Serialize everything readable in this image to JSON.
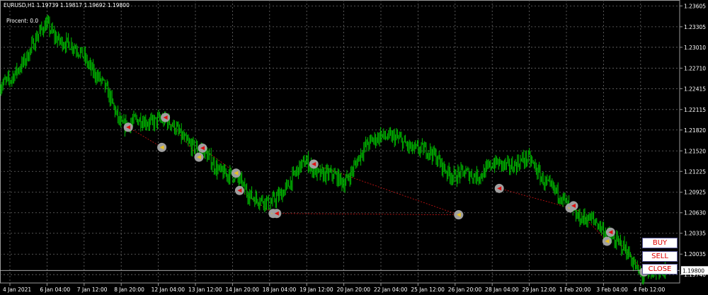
{
  "header": {
    "symbol_line": "EURUSD,H1  1.19739 1.19817 1.19692 1.19800",
    "procent": "Procent: 0.0"
  },
  "buttons": {
    "buy": "BUY",
    "sell": "SELL",
    "close": "CLOSE"
  },
  "colors": {
    "background": "#000000",
    "price": "#00c000",
    "grid": "#6b6b6b",
    "axis_text": "#ffffff",
    "trade_line": "#d01414",
    "marker_ring": "#a0a0a0",
    "button_text": "#e00000"
  },
  "price_axis": {
    "labels": [
      "1.23605",
      "1.23305",
      "1.23010",
      "1.22710",
      "1.22415",
      "1.22115",
      "1.21820",
      "1.21520",
      "1.21225",
      "1.20925",
      "1.20630",
      "1.20335",
      "1.20035",
      "1.19740"
    ],
    "current": "1.19800"
  },
  "time_axis": {
    "labels": [
      "4 Jan 2021",
      "6 Jan 04:00",
      "7 Jan 12:00",
      "8 Jan 20:00",
      "12 Jan 04:00",
      "13 Jan 12:00",
      "14 Jan 20:00",
      "18 Jan 04:00",
      "19 Jan 12:00",
      "20 Jan 20:00",
      "22 Jan 04:00",
      "25 Jan 12:00",
      "26 Jan 20:00",
      "28 Jan 04:00",
      "29 Jan 12:00",
      "1 Feb 20:00",
      "3 Feb 04:00",
      "4 Feb 12:00"
    ]
  },
  "chart_data": {
    "type": "line",
    "title": "EURUSD,H1",
    "ylim": [
      1.1962,
      1.2369
    ],
    "x": [
      "4 Jan 2021",
      "6 Jan 04:00",
      "7 Jan 12:00",
      "8 Jan 20:00",
      "12 Jan 04:00",
      "13 Jan 12:00",
      "14 Jan 20:00",
      "18 Jan 04:00",
      "19 Jan 12:00",
      "20 Jan 20:00",
      "22 Jan 04:00",
      "25 Jan 12:00",
      "26 Jan 20:00",
      "28 Jan 04:00",
      "29 Jan 12:00",
      "1 Feb 20:00",
      "3 Feb 04:00",
      "4 Feb 12:00"
    ],
    "series": [
      {
        "values": [
          1.2245,
          1.2335,
          1.229,
          1.219,
          1.2205,
          1.215,
          1.212,
          1.2065,
          1.214,
          1.2105,
          1.218,
          1.216,
          1.211,
          1.2135,
          1.213,
          1.208,
          1.2035,
          1.198
        ]
      }
    ],
    "trades": [
      {
        "type": "sell",
        "open_time": "8 Jan 20:00",
        "open_price": 1.2186,
        "close_time": "12 Jan 04:00",
        "close_price": 1.2157
      },
      {
        "type": "sell",
        "open_time": "12 Jan 04:00",
        "open_price": 1.22,
        "close_time": "13 Jan 12:00",
        "close_price": 1.2143
      },
      {
        "type": "sell",
        "open_time": "13 Jan 12:00",
        "open_price": 1.2156,
        "close_time": "14 Jan 20:00",
        "close_price": 1.212
      },
      {
        "type": "sell",
        "open_time": "14 Jan 20:00",
        "open_price": 1.2095,
        "close_time": "18 Jan 04:00",
        "close_price": 1.2062
      },
      {
        "type": "sell",
        "open_time": "18 Jan 04:00",
        "open_price": 1.2062,
        "close_time": "26 Jan 20:00",
        "close_price": 1.206
      },
      {
        "type": "sell",
        "open_time": "19 Jan 12:00",
        "open_price": 1.2133,
        "close_time": "26 Jan 20:00",
        "close_price": 1.206
      },
      {
        "type": "sell",
        "open_time": "28 Jan 04:00",
        "open_price": 1.2098,
        "close_time": "1 Feb 20:00",
        "close_price": 1.207
      },
      {
        "type": "sell",
        "open_time": "1 Feb 20:00",
        "open_price": 1.2073,
        "close_time": "3 Feb 04:00",
        "close_price": 1.2022
      },
      {
        "type": "sell",
        "open_time": "3 Feb 04:00",
        "open_price": 1.2035,
        "close_time": "4 Feb 12:00",
        "close_price": 1.1978
      }
    ]
  }
}
